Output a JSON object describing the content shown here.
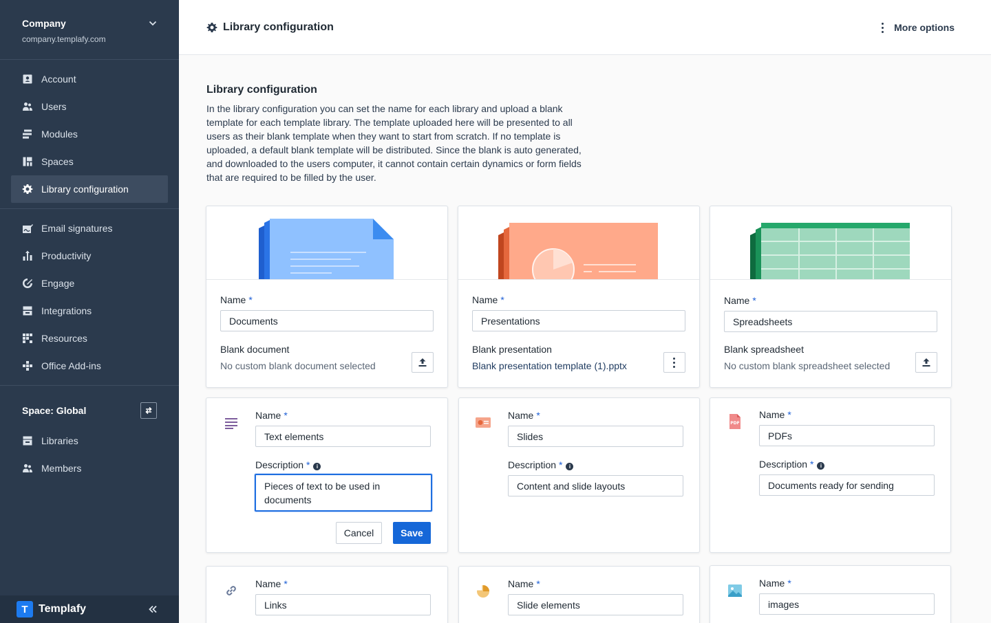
{
  "sidebar": {
    "company_name": "Company",
    "company_domain": "company.templafy.com",
    "nav_main": [
      {
        "label": "Account",
        "icon": "account-icon"
      },
      {
        "label": "Users",
        "icon": "users-icon"
      },
      {
        "label": "Modules",
        "icon": "modules-icon"
      },
      {
        "label": "Spaces",
        "icon": "spaces-icon"
      },
      {
        "label": "Library configuration",
        "icon": "gear-icon",
        "active": true
      }
    ],
    "nav_secondary": [
      {
        "label": "Email signatures",
        "icon": "signature-icon"
      },
      {
        "label": "Productivity",
        "icon": "productivity-icon"
      },
      {
        "label": "Engage",
        "icon": "engage-icon"
      },
      {
        "label": "Integrations",
        "icon": "integrations-icon"
      },
      {
        "label": "Resources",
        "icon": "resources-icon"
      },
      {
        "label": "Office Add-ins",
        "icon": "add-ins-icon"
      }
    ],
    "space_label": "Space: Global",
    "nav_space": [
      {
        "label": "Libraries",
        "icon": "libraries-icon"
      },
      {
        "label": "Members",
        "icon": "members-icon"
      }
    ],
    "brand": "Templafy",
    "brand_mark": "T"
  },
  "header": {
    "title": "Library configuration",
    "more_options": "More options"
  },
  "intro": {
    "title": "Library configuration",
    "text": "In the library configuration you can set the name for each library and upload a blank template for each template library. The template uploaded here will be presented to all users as their blank template when they want to start from scratch. If no template is uploaded, a default blank template will be distributed. Since the blank is auto generated, and downloaded to the users computer, it cannot contain certain dynamics or form fields that are required to be filled by the user."
  },
  "labels": {
    "name": "Name",
    "description": "Description",
    "required": "*",
    "info": "i",
    "cancel": "Cancel",
    "save": "Save"
  },
  "template_libraries": [
    {
      "name": "Documents",
      "blank_label": "Blank document",
      "blank_status": "No custom blank document selected",
      "action": "upload-icon",
      "color": "#8fc1ff"
    },
    {
      "name": "Presentations",
      "blank_label": "Blank presentation",
      "blank_status": "Blank presentation template (1).pptx",
      "action": "kebab-icon",
      "color": "#ffa98a"
    },
    {
      "name": "Spreadsheets",
      "blank_label": "Blank spreadsheet",
      "blank_status": "No custom blank spreadsheet selected",
      "action": "upload-icon",
      "color": "#9ed8bd"
    }
  ],
  "asset_libraries": [
    {
      "name": "Text elements",
      "description": "Pieces of text to be used in documents",
      "icon": "text-lines-icon",
      "editing": true
    },
    {
      "name": "Slides",
      "description": "Content and slide layouts",
      "icon": "slide-icon"
    },
    {
      "name": "PDFs",
      "description": "Documents ready for sending",
      "icon": "pdf-icon",
      "icon_text": "PDF"
    },
    {
      "name": "Links",
      "icon": "link-icon"
    },
    {
      "name": "Slide elements",
      "icon": "pie-chart-icon"
    },
    {
      "name": "images",
      "icon": "image-icon"
    }
  ]
}
